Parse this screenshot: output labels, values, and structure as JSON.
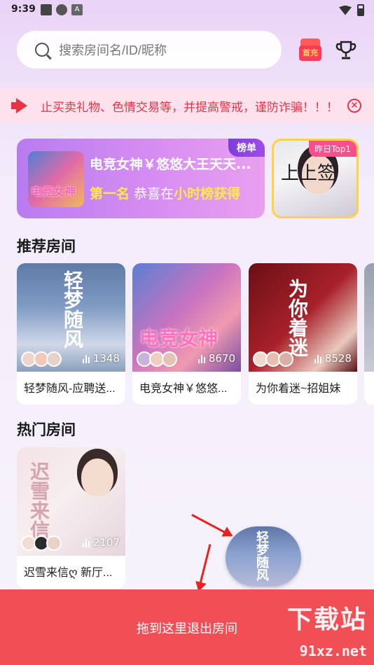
{
  "status_bar": {
    "time": "9:39",
    "app_icon_label": "A"
  },
  "search": {
    "placeholder": "搜索房间名/ID/昵称"
  },
  "header": {
    "first_charge_label": "首充"
  },
  "notice": {
    "text": "止买卖礼物、色情交易等，并提高警戒，谨防诈骗！！！",
    "close_label": "×"
  },
  "rank_banner": {
    "tag": "榜单",
    "title": "电竞女神￥悠悠大王天天...",
    "rank_text": "第一名",
    "congrats_prefix": "恭喜在",
    "congrats_highlight": "小时榜获得",
    "thumb_text": "电竞女神"
  },
  "top1_card": {
    "badge": "昨日Top1",
    "calligraphy": "上上签"
  },
  "recommended": {
    "title": "推荐房间",
    "rooms": [
      {
        "name": "轻梦随风-应聘送...",
        "count": "1348",
        "cover_text": "轻梦随风"
      },
      {
        "name": "电竞女神￥悠悠...",
        "count": "8670",
        "cover_text": "电竞女神"
      },
      {
        "name": "为你着迷~招姐妹",
        "count": "8528",
        "cover_text": "为你着迷"
      }
    ]
  },
  "hot": {
    "title": "热门房间",
    "rooms": [
      {
        "name": "迟雪来信ღ 新厅...",
        "count": "2107",
        "cover_text": "迟雪来信"
      }
    ]
  },
  "floating_room": {
    "cover_text": "轻梦随风"
  },
  "exit_zone": {
    "label": "拖到这里退出房间"
  },
  "watermark": {
    "big": "下载站",
    "small": "91xz.net"
  },
  "colors": {
    "accent_red": "#f14e55",
    "notice_red": "#e83545",
    "banner_purple": "#b87cf0",
    "highlight_yellow": "#ffe84a"
  }
}
